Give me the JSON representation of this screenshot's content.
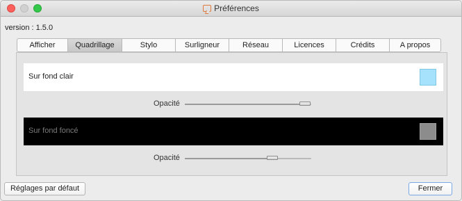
{
  "window": {
    "title": "Préférences",
    "title_icon": "speech-bubble-icon"
  },
  "version": "version : 1.5.0",
  "tabs": [
    {
      "label": "Afficher"
    },
    {
      "label": "Quadrillage",
      "active": true
    },
    {
      "label": "Stylo"
    },
    {
      "label": "Surligneur"
    },
    {
      "label": "Réseau"
    },
    {
      "label": "Licences"
    },
    {
      "label": "Crédits"
    },
    {
      "label": "A propos"
    }
  ],
  "light_background": {
    "label": "Sur fond clair",
    "color": "#a6e2fb",
    "opacity_label": "Opacité",
    "opacity": 0.95
  },
  "dark_background": {
    "label": "Sur fond foncé",
    "color": "#8c8c8c",
    "opacity_label": "Opacité",
    "opacity": 0.69
  },
  "buttons": {
    "defaults": "Réglages par défaut",
    "close": "Fermer"
  },
  "colors": {
    "accent": "#7aa7e6",
    "light_bar": "#ffffff",
    "dark_bar": "#000000"
  }
}
